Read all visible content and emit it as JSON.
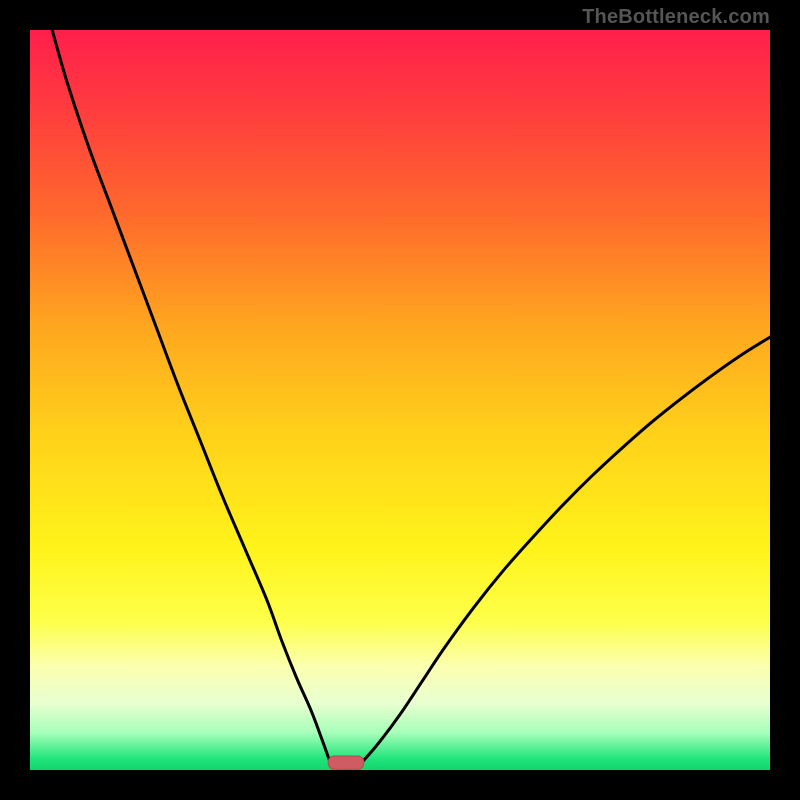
{
  "watermark": "TheBottleneck.com",
  "colors": {
    "frame": "#000000",
    "curve": "#000000",
    "marker_fill": "#cf5b63",
    "marker_stroke": "#b24b52",
    "gradient_stops": [
      {
        "offset": 0.0,
        "color": "#ff1f4b"
      },
      {
        "offset": 0.1,
        "color": "#ff3a3f"
      },
      {
        "offset": 0.25,
        "color": "#ff6a2c"
      },
      {
        "offset": 0.4,
        "color": "#ffa61f"
      },
      {
        "offset": 0.55,
        "color": "#ffd21a"
      },
      {
        "offset": 0.7,
        "color": "#fff31a"
      },
      {
        "offset": 0.8,
        "color": "#fdff4a"
      },
      {
        "offset": 0.86,
        "color": "#fbffb0"
      },
      {
        "offset": 0.91,
        "color": "#e8ffd0"
      },
      {
        "offset": 0.95,
        "color": "#a6ffb9"
      },
      {
        "offset": 0.985,
        "color": "#20e57a"
      },
      {
        "offset": 1.0,
        "color": "#12d56e"
      }
    ]
  },
  "chart_data": {
    "type": "line",
    "title": "",
    "xlabel": "",
    "ylabel": "",
    "xlim": [
      0,
      100
    ],
    "ylim": [
      0,
      100
    ],
    "grid": false,
    "series": [
      {
        "name": "left-branch",
        "x": [
          3,
          5,
          8,
          11,
          14,
          17,
          20,
          23,
          26,
          29,
          32,
          34,
          36,
          38,
          39.5,
          40.5
        ],
        "values": [
          100,
          93,
          84,
          76,
          68,
          60,
          52,
          44.5,
          37,
          30,
          23,
          17.5,
          12.5,
          8,
          4,
          1.2
        ]
      },
      {
        "name": "right-branch",
        "x": [
          45,
          47,
          50,
          53,
          56,
          60,
          64,
          68,
          72,
          76,
          80,
          84,
          88,
          92,
          96,
          100
        ],
        "values": [
          1.2,
          3.5,
          7.5,
          12,
          16.5,
          22,
          27,
          31.5,
          35.8,
          39.8,
          43.5,
          47,
          50.2,
          53.2,
          56,
          58.5
        ]
      }
    ],
    "marker": {
      "x": 42.7,
      "y": 1.0,
      "rx": 2.4,
      "ry": 0.9
    }
  }
}
